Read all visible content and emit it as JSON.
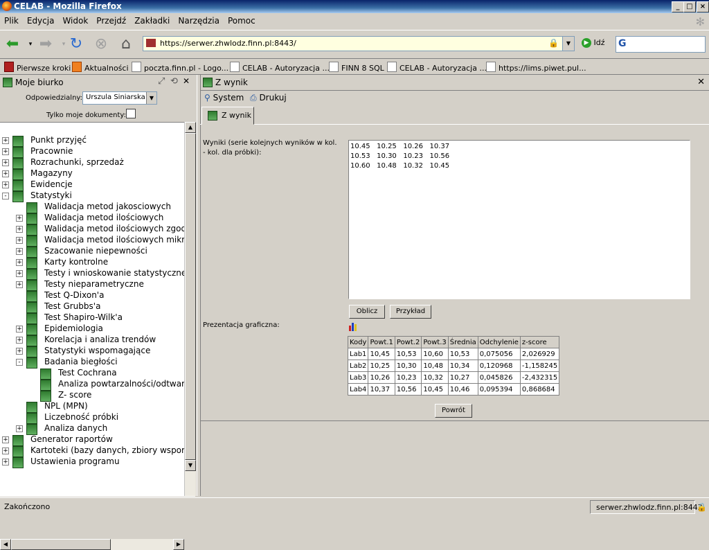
{
  "window": {
    "title": "CELAB - Mozilla Firefox"
  },
  "menu": [
    "Plik",
    "Edycja",
    "Widok",
    "Przejdź",
    "Zakładki",
    "Narzędzia",
    "Pomoc"
  ],
  "nav": {
    "url": "https://serwer.zhwlodz.finn.pl:8443/",
    "go_label": "Idź"
  },
  "bookmarks": [
    "Pierwsze kroki",
    "Aktualności",
    "poczta.finn.pl - Logo...",
    "CELAB - Autoryzacja ...",
    "FINN 8 SQL",
    "CELAB - Autoryzacja ...",
    "https://lims.piwet.pul..."
  ],
  "left": {
    "title": "Moje biurko",
    "odp_label": "Odpowiedzialny:",
    "odp_value": "Urszula Siniarska",
    "tylko_label": "Tylko moje dokumenty:",
    "tree": [
      {
        "label": "Punkt przyjęć",
        "level": 0,
        "exp": "+"
      },
      {
        "label": "Pracownie",
        "level": 0,
        "exp": "+"
      },
      {
        "label": "Rozrachunki, sprzedaż",
        "level": 0,
        "exp": "+"
      },
      {
        "label": "Magazyny",
        "level": 0,
        "exp": "+"
      },
      {
        "label": "Ewidencje",
        "level": 0,
        "exp": "+"
      },
      {
        "label": "Statystyki",
        "level": 0,
        "exp": "-"
      },
      {
        "label": "Walidacja metod jakosciowych",
        "level": 1,
        "exp": ""
      },
      {
        "label": "Walidacja metod ilościowych",
        "level": 1,
        "exp": "+"
      },
      {
        "label": "Walidacja metod ilościowych zgodnie",
        "level": 1,
        "exp": "+"
      },
      {
        "label": "Walidacja metod ilościowych mikrobi",
        "level": 1,
        "exp": "+"
      },
      {
        "label": "Szacowanie niepewności",
        "level": 1,
        "exp": "+"
      },
      {
        "label": "Karty kontrolne",
        "level": 1,
        "exp": "+"
      },
      {
        "label": "Testy i wnioskowanie statystyczne",
        "level": 1,
        "exp": "+"
      },
      {
        "label": "Testy nieparametryczne",
        "level": 1,
        "exp": "+"
      },
      {
        "label": "Test Q-Dixon'a",
        "level": 1,
        "exp": ""
      },
      {
        "label": "Test Grubbs'a",
        "level": 1,
        "exp": ""
      },
      {
        "label": "Test Shapiro-Wilk'a",
        "level": 1,
        "exp": ""
      },
      {
        "label": "Epidemiologia",
        "level": 1,
        "exp": "+"
      },
      {
        "label": "Korelacja i analiza trendów",
        "level": 1,
        "exp": "+"
      },
      {
        "label": "Statystyki wspomagające",
        "level": 1,
        "exp": "+"
      },
      {
        "label": "Badania biegłości",
        "level": 1,
        "exp": "-"
      },
      {
        "label": "Test Cochrana",
        "level": 2,
        "exp": ""
      },
      {
        "label": "Analiza powtarzalności/odtwarzalı",
        "level": 2,
        "exp": ""
      },
      {
        "label": "Z- score",
        "level": 2,
        "exp": ""
      },
      {
        "label": "NPL (MPN)",
        "level": 1,
        "exp": ""
      },
      {
        "label": "Liczebność próbki",
        "level": 1,
        "exp": ""
      },
      {
        "label": "Analiza danych",
        "level": 1,
        "exp": "+"
      },
      {
        "label": "Generator raportów",
        "level": 0,
        "exp": "+"
      },
      {
        "label": "Kartoteki (bazy danych, zbiory wspomaga",
        "level": 0,
        "exp": "+"
      },
      {
        "label": "Ustawienia programu",
        "level": 0,
        "exp": "+"
      }
    ]
  },
  "right": {
    "title": "Z wynik",
    "tool_system": "System",
    "tool_drukuj": "Drukuj",
    "tab": "Z wynik",
    "wyniki_label": "Wyniki (serie kolejnych wyników w kol. - kol. dla próbki):",
    "wyniki_lines": [
      "10.45   10.25   10.26   10.37",
      "10.53   10.30   10.23   10.56",
      "10.60   10.48   10.32   10.45"
    ],
    "oblicz": "Oblicz",
    "przyklad": "Przykład",
    "prez_label": "Prezentacja graficzna:",
    "table": {
      "headers": [
        "Kody",
        "Powt.1",
        "Powt.2",
        "Powt.3",
        "Średnia",
        "Odchylenie",
        "z-score"
      ],
      "rows": [
        [
          "Lab1",
          "10,45",
          "10,53",
          "10,60",
          "10,53",
          "0,075056",
          "2,026929"
        ],
        [
          "Lab2",
          "10,25",
          "10,30",
          "10,48",
          "10,34",
          "0,120968",
          "-1,158245"
        ],
        [
          "Lab3",
          "10,26",
          "10,23",
          "10,32",
          "10,27",
          "0,045826",
          "-2,432315"
        ],
        [
          "Lab4",
          "10,37",
          "10,56",
          "10,45",
          "10,46",
          "0,095394",
          "0,868684"
        ]
      ]
    },
    "powrot": "Powrót"
  },
  "status": {
    "left": "Zakończono",
    "right": "serwer.zhwlodz.finn.pl:8443"
  }
}
